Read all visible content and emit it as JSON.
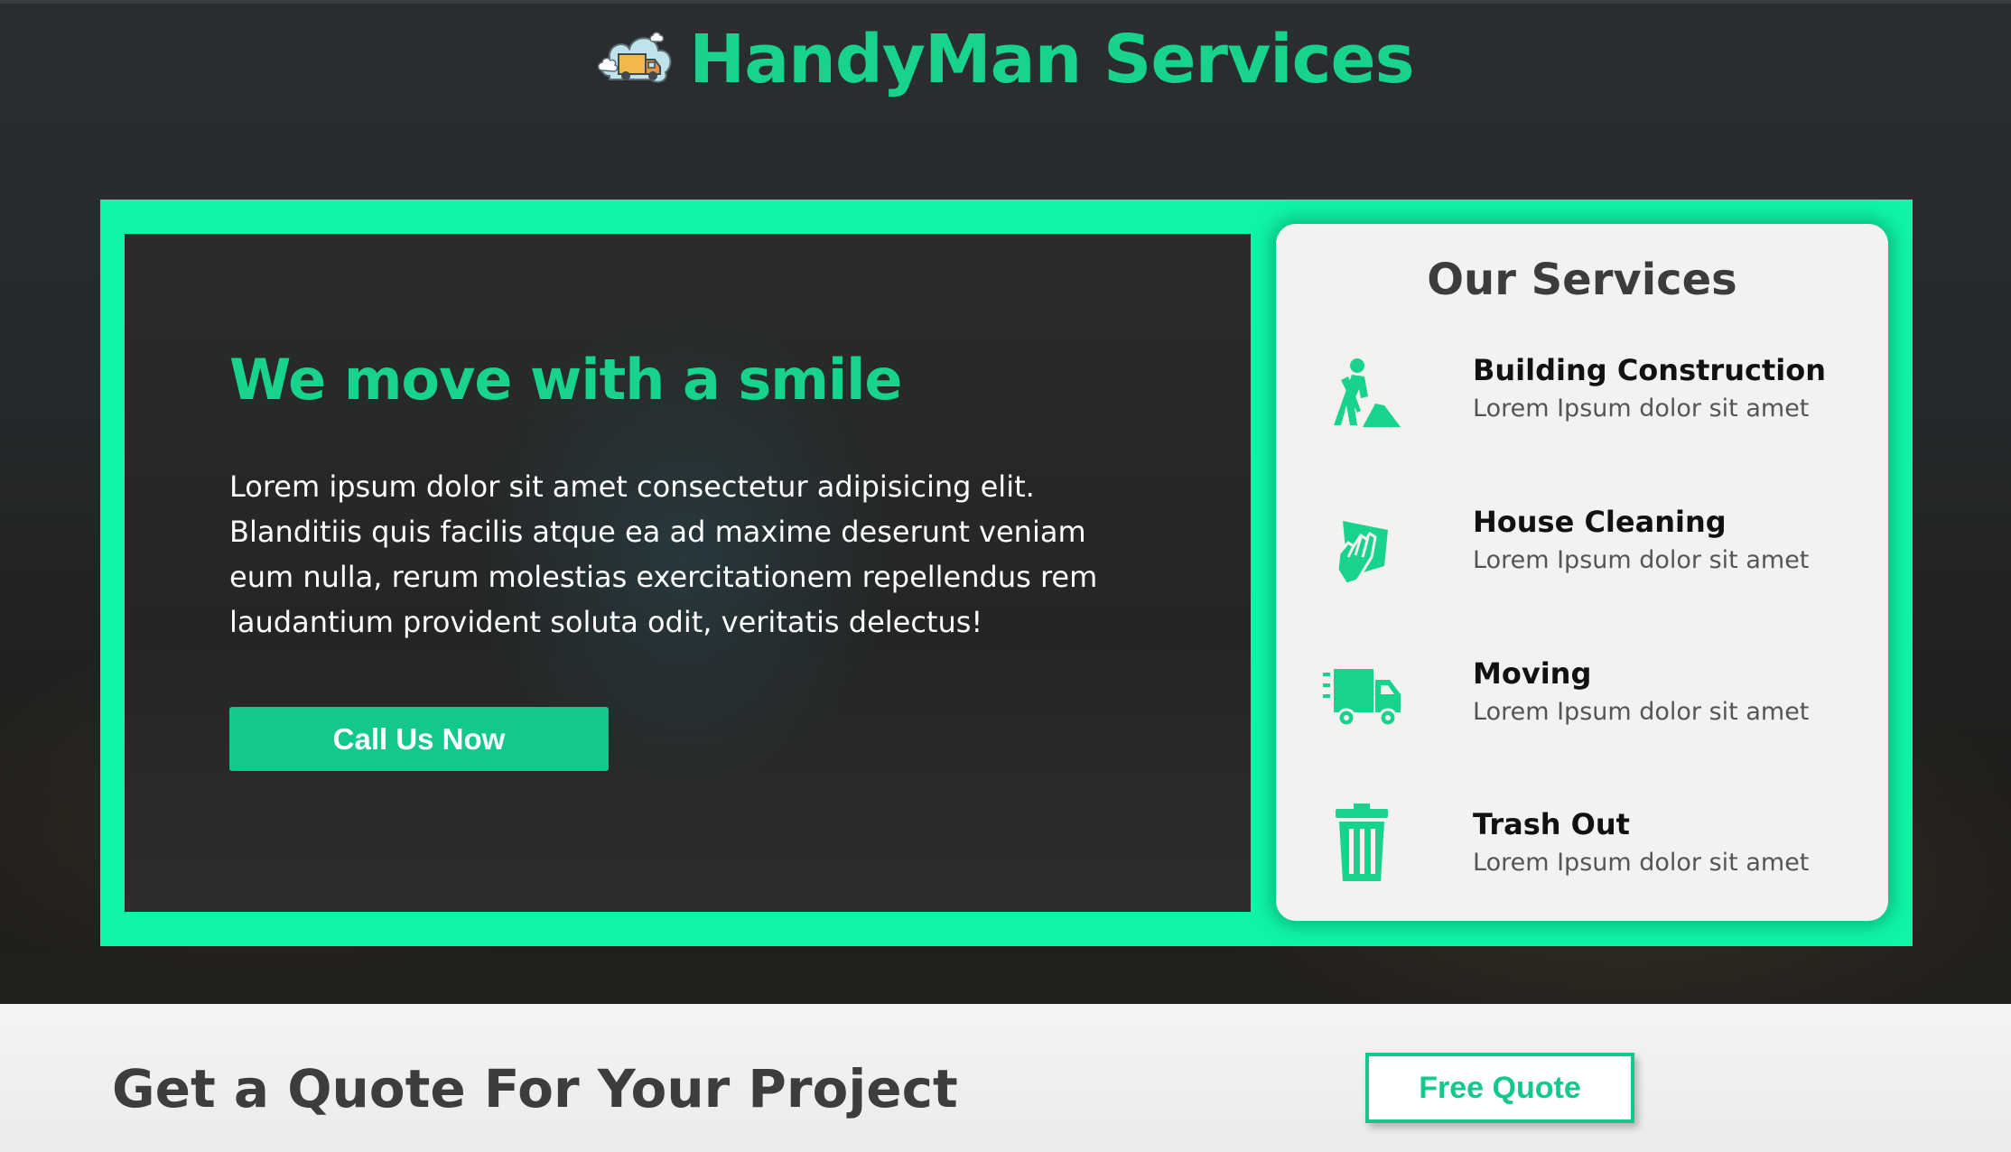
{
  "brand": {
    "title": "HandyMan Services",
    "logo_icon": "moving-truck-cloud-icon"
  },
  "hero": {
    "title": "We move with a smile",
    "text": "Lorem ipsum dolor sit amet consectetur adipisicing elit. Blanditiis quis facilis atque ea ad maxime deserunt veniam eum nulla, rerum molestias exercitationem repellendus rem laudantium provident soluta odit, veritatis delectus!",
    "cta_label": "Call Us Now"
  },
  "services": {
    "title": "Our Services",
    "items": [
      {
        "name": "Building Construction",
        "desc": "Lorem Ipsum dolor sit amet",
        "icon": "digging-worker-icon"
      },
      {
        "name": "House Cleaning",
        "desc": "Lorem Ipsum dolor sit amet",
        "icon": "cleaning-hand-icon"
      },
      {
        "name": "Moving",
        "desc": "Lorem Ipsum dolor sit amet",
        "icon": "truck-icon"
      },
      {
        "name": "Trash Out",
        "desc": "Lorem Ipsum dolor sit amet",
        "icon": "trash-can-icon"
      }
    ]
  },
  "quote": {
    "title": "Get a Quote For Your Project",
    "button_label": "Free Quote"
  },
  "colors": {
    "accent": "#17d38c",
    "frame": "#0ff4a6",
    "button": "#12c98a"
  }
}
